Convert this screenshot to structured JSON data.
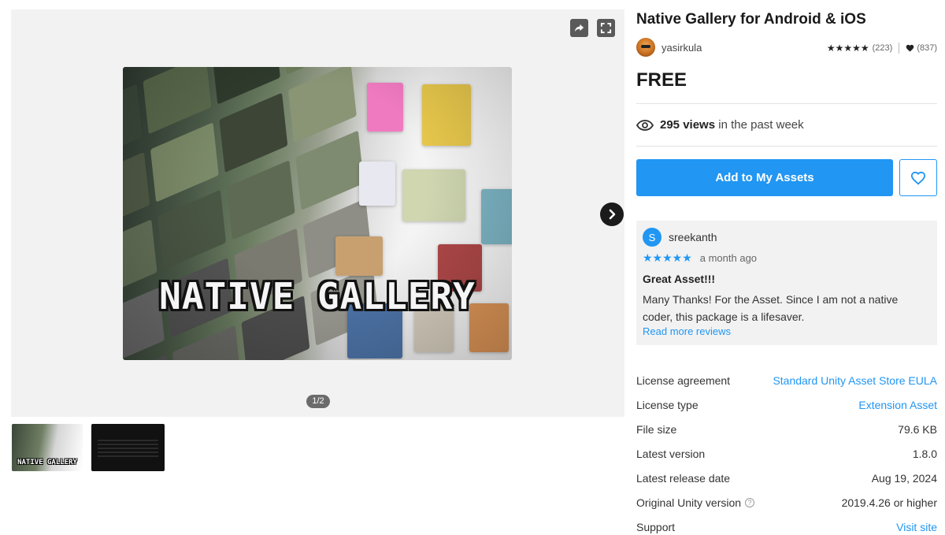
{
  "asset": {
    "title": "Native Gallery for Android & iOS",
    "publisher": "yasirkula",
    "rating_stars": "★★★★★",
    "rating_count": "(223)",
    "favorites_count": "(837)",
    "price": "FREE",
    "views_count": "295 views",
    "views_suffix": "in the past week"
  },
  "media": {
    "hero_text": "NATIVE GALLERY",
    "pager": "1/2",
    "thumb_1_text": "NATIVE GALLERY"
  },
  "actions": {
    "add_label": "Add to My Assets"
  },
  "review": {
    "avatar_letter": "S",
    "author": "sreekanth",
    "stars": "★★★★★",
    "time": "a month ago",
    "title": "Great Asset!!!",
    "body": "Many Thanks! For the Asset. Since I am not a native coder, this package is a lifesaver.",
    "more_link": "Read more reviews"
  },
  "details": [
    {
      "key": "License agreement",
      "value": "Standard Unity Asset Store EULA",
      "link": true
    },
    {
      "key": "License type",
      "value": "Extension Asset",
      "link": true
    },
    {
      "key": "File size",
      "value": "79.6 KB",
      "link": false
    },
    {
      "key": "Latest version",
      "value": "1.8.0",
      "link": false
    },
    {
      "key": "Latest release date",
      "value": "Aug 19, 2024",
      "link": false
    },
    {
      "key": "Original Unity version",
      "value": "2019.4.26 or higher",
      "link": false,
      "help": "?"
    },
    {
      "key": "Support",
      "value": "Visit site",
      "link": true
    }
  ],
  "colors": {
    "accent": "#2196f3",
    "dark_button": "#5a5a5a"
  },
  "icons": {
    "share": "share-icon",
    "fullscreen": "fullscreen-icon",
    "next": "chevron-right-icon",
    "eye": "eye-icon",
    "heart": "heart-icon"
  }
}
